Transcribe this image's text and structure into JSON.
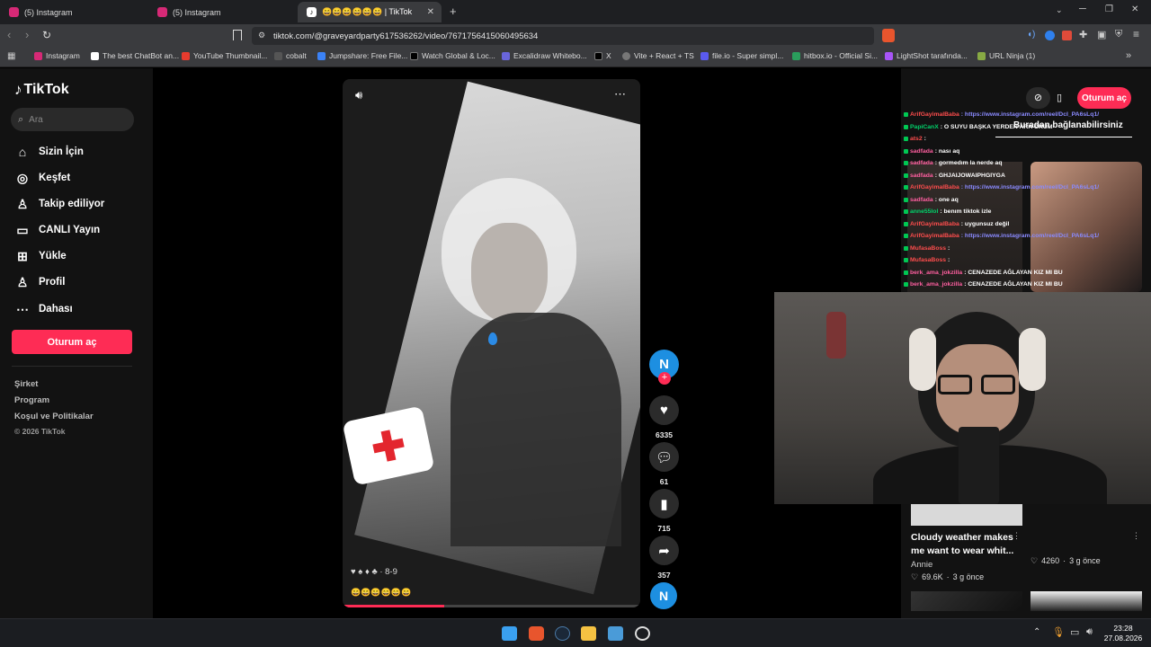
{
  "tabs": [
    {
      "label": "(5) Instagram",
      "favicon": "instagram-icon"
    },
    {
      "label": "(5) Instagram",
      "favicon": "instagram-icon"
    },
    {
      "label": "😄😄😄😄😄😄 | TikTok",
      "favicon": "tiktok-icon"
    }
  ],
  "new_tab_label": "+",
  "address_bar": {
    "url": "tiktok.com/@graveyardparty617536262/video/7671756415060495634"
  },
  "bookmarks": [
    {
      "label": "Instagram",
      "color": "#d62976"
    },
    {
      "label": "The best ChatBot an...",
      "color": "#ffffff"
    },
    {
      "label": "YouTube Thumbnail...",
      "color": "#e63b2e"
    },
    {
      "label": "cobalt",
      "color": "#333333"
    },
    {
      "label": "Jumpshare: Free File...",
      "color": "#3b82f6"
    },
    {
      "label": "Watch Global & Loc...",
      "color": "#000000"
    },
    {
      "label": "Excalidraw Whitebo...",
      "color": "#6965db"
    },
    {
      "label": "X",
      "color": "#000000"
    },
    {
      "label": "Vite + React + TS",
      "color": "#666666"
    },
    {
      "label": "file.io - Super simpl...",
      "color": "#5a5af0"
    },
    {
      "label": "hitbox.io - Official Si...",
      "color": "#2a9d5c"
    },
    {
      "label": "LightShot tarafında...",
      "color": "#a855f7"
    },
    {
      "label": "URL Ninja (1)",
      "color": "#88aa44"
    }
  ],
  "sidebar": {
    "logo": "TikTok",
    "search_placeholder": "Ara",
    "nav": [
      {
        "label": "Sizin İçin",
        "icon": "home-icon"
      },
      {
        "label": "Keşfet",
        "icon": "compass-icon"
      },
      {
        "label": "Takip ediliyor",
        "icon": "following-icon"
      },
      {
        "label": "CANLI Yayın",
        "icon": "live-icon"
      },
      {
        "label": "Yükle",
        "icon": "upload-icon"
      },
      {
        "label": "Profil",
        "icon": "profile-icon"
      },
      {
        "label": "Dahası",
        "icon": "more-icon"
      }
    ],
    "login_button": "Oturum aç",
    "footer": [
      "Şirket",
      "Program",
      "Koşul ve Politikalar",
      "© 2026 TikTok"
    ]
  },
  "video": {
    "sticker_caption": "♥ ♠ ♦ ♣ · 8-9",
    "emoji_row": "😄😄😄😄😄😄",
    "progress": 0.34
  },
  "actions": {
    "avatar_letter": "N",
    "likes": "6335",
    "comments": "61",
    "saves": "715",
    "shares": "357"
  },
  "right_panel": {
    "login_button": "Oturum aç",
    "header_text": "Buradan bağlanabilirsiniz",
    "chat": [
      {
        "user": "ArifGayimalBaba",
        "text": ": https://www.instagram.com/reel/DcI_PA6sLq1/",
        "user_color": "#ff4d4d",
        "text_color": "#8a8aff"
      },
      {
        "user": "PapiCanX",
        "text": ": O SUYU BAŞKA YERDEN ARIYORUM",
        "user_color": "#00d26a",
        "text_color": "#ffffff"
      },
      {
        "user": "ats2",
        "text": ":",
        "user_color": "#ff4d4d",
        "text_color": "#ffffff"
      },
      {
        "user": "sadfada",
        "text": ": nası aq",
        "user_color": "#ff5fa0",
        "text_color": "#ffffff"
      },
      {
        "user": "sadfada",
        "text": ": gormedım la nerde aq",
        "user_color": "#ff5fa0",
        "text_color": "#ffffff"
      },
      {
        "user": "sadfada",
        "text": ": GHJAIJOWAIPHGIYGA",
        "user_color": "#ff5fa0",
        "text_color": "#ffffff"
      },
      {
        "user": "ArifGayimalBaba",
        "text": ": https://www.instagram.com/reel/DcI_PA6sLq1/",
        "user_color": "#ff4d4d",
        "text_color": "#8a8aff"
      },
      {
        "user": "sadfada",
        "text": ": one aq",
        "user_color": "#ff5fa0",
        "text_color": "#ffffff"
      },
      {
        "user": "anne55lol",
        "text": ": benım tiktok izle",
        "user_color": "#00d26a",
        "text_color": "#ffffff"
      },
      {
        "user": "ArifGayimalBaba",
        "text": ": uygunsuz değil",
        "user_color": "#ff4d4d",
        "text_color": "#ffffff"
      },
      {
        "user": "ArifGayimalBaba",
        "text": ": https://www.instagram.com/reel/DcI_PA6sLq1/",
        "user_color": "#ff4d4d",
        "text_color": "#8a8aff"
      },
      {
        "user": "MufasaBoss",
        "text": ":",
        "user_color": "#ff4d4d",
        "text_color": "#ffffff"
      },
      {
        "user": "MufasaBoss",
        "text": ":",
        "user_color": "#ff4d4d",
        "text_color": "#ffffff"
      },
      {
        "user": "berk_ama_jokzilla",
        "text": ": CENAZEDE AĞLAYAN KIZ MI BU",
        "user_color": "#ff5fa0",
        "text_color": "#ffffff"
      },
      {
        "user": "berk_ama_jokzilla",
        "text": ": CENAZEDE AĞLAYAN KIZ MI BU",
        "user_color": "#ff5fa0",
        "text_color": "#ffffff"
      }
    ],
    "card_left": {
      "title": "Cloudy weather makes me want to wear whit...",
      "author": "Annie",
      "likes": "69.6K",
      "age": "3 g önce"
    },
    "card_right": {
      "likes": "4260",
      "age": "3 g önce"
    }
  },
  "taskbar": {
    "time": "23:28",
    "date": "27.08.2026"
  },
  "colors": {
    "accent": "#fe2c55",
    "avatar_blue": "#1d8fe1"
  }
}
